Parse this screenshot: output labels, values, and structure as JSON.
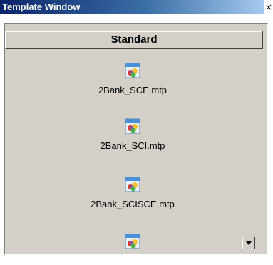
{
  "window": {
    "title": "Template Window",
    "close_glyph": "×"
  },
  "section": {
    "header": "Standard"
  },
  "items": [
    {
      "label": "2Bank_SCE.mtp",
      "icon": "template-file-icon"
    },
    {
      "label": "2Bank_SCI.mtp",
      "icon": "template-file-icon"
    },
    {
      "label": "2Bank_SCISCE.mtp",
      "icon": "template-file-icon"
    },
    {
      "label": "",
      "icon": "template-file-icon"
    }
  ],
  "scrollbar": {
    "down_icon": "scroll-down-arrow-icon"
  },
  "colors": {
    "title_start": "#0a246a",
    "title_end": "#a6caf0",
    "panel_bg": "#d4d0c8"
  }
}
